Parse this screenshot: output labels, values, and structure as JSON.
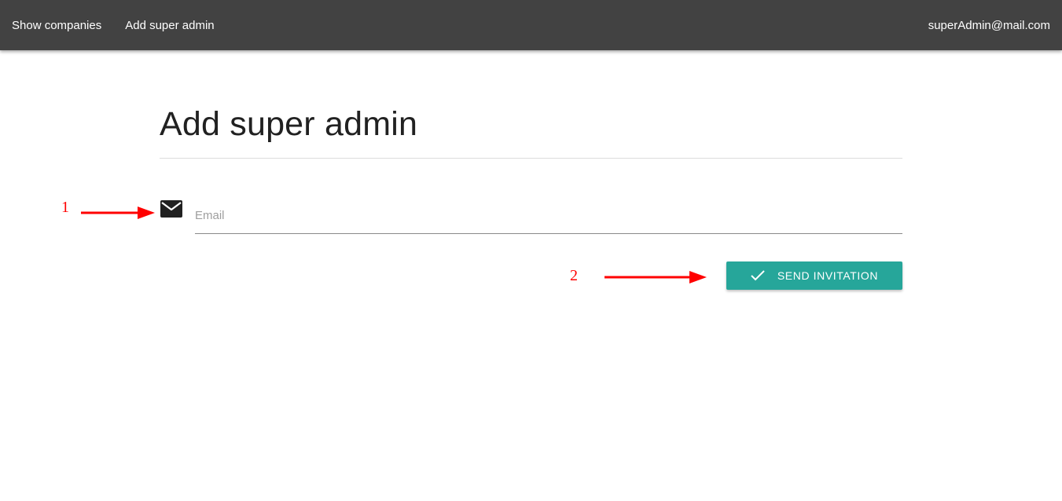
{
  "topbar": {
    "nav_items": [
      {
        "label": "Show companies"
      },
      {
        "label": "Add super admin"
      }
    ],
    "user_email": "superAdmin@mail.com",
    "background": "#424242"
  },
  "main": {
    "title": "Add super admin",
    "email_field": {
      "placeholder": "Email",
      "value": "",
      "icon": "mail-icon"
    },
    "send_button": {
      "label": "SEND INVITATION",
      "icon": "check-icon",
      "color": "#26a69a"
    }
  },
  "annotations": {
    "marker_1": "1",
    "marker_2": "2",
    "color": "#ff0000"
  }
}
